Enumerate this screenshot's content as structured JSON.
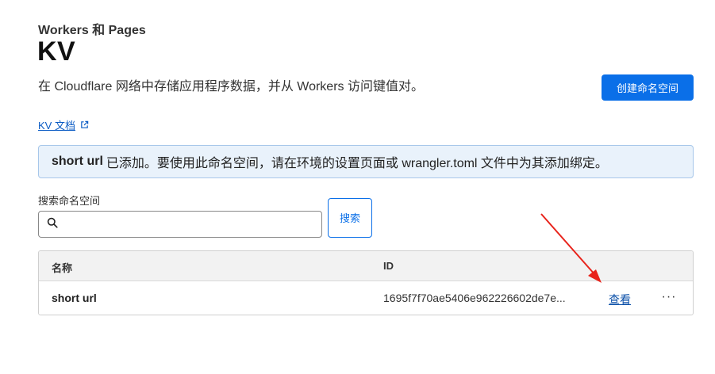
{
  "header": {
    "breadcrumb": "Workers 和 Pages",
    "title": "KV",
    "description": "在 Cloudflare 网络中存储应用程序数据，并从 Workers 访问键值对。",
    "create_button": "创建命名空间",
    "doc_link": "KV 文档"
  },
  "alert": {
    "name": "short url",
    "message": "已添加。要使用此命名空间，请在环境的设置页面或 wrangler.toml 文件中为其添加绑定。"
  },
  "search": {
    "label": "搜索命名空间",
    "value": "",
    "placeholder": "",
    "button": "搜索"
  },
  "table": {
    "columns": [
      "名称",
      "ID"
    ],
    "rows": [
      {
        "name": "short url",
        "id": "1695f7f70ae5406e962226602de7e...",
        "action": "查看",
        "more": "···"
      }
    ]
  },
  "icons": {
    "external_link": "external-link-icon",
    "search": "search-icon",
    "more": "more-icon"
  },
  "colors": {
    "accent": "#0a6fe8",
    "alert_bg": "#e9f2fb",
    "annotation_arrow": "#e8231b"
  }
}
